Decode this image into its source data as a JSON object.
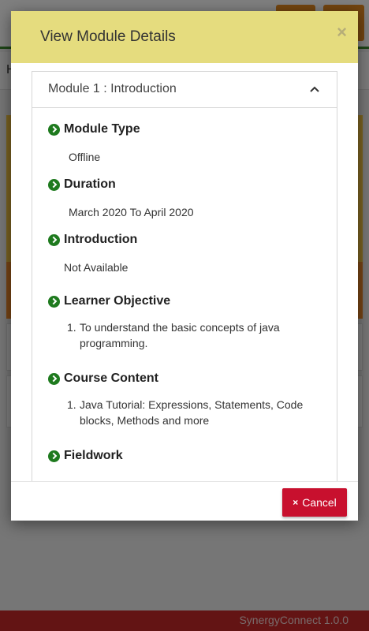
{
  "background": {
    "breadcrumb_initial": "H",
    "footer_text": "SynergyConnect 1.0.0"
  },
  "modal": {
    "title": "View Module Details",
    "close_glyph": "×",
    "panel_title": "Module 1 : Introduction",
    "sections": [
      {
        "title": "Module Type",
        "value": "Offline"
      },
      {
        "title": "Duration",
        "value": "March 2020 To April 2020"
      },
      {
        "title": "Introduction",
        "value": "Not Available"
      },
      {
        "title": "Learner Objective",
        "item_num": "1.",
        "item": "To understand the basic concepts of java programming."
      },
      {
        "title": "Course Content",
        "item_num": "1.",
        "item": "Java Tutorial: Expressions, Statements, Code blocks, Methods and more"
      },
      {
        "title": "Fieldwork"
      }
    ],
    "cancel_label": "Cancel",
    "cancel_icon": "×"
  },
  "colors": {
    "header_bg": "#e5dc7e",
    "icon_green": "#1e7a1e",
    "cancel_red": "#c8102e",
    "footer_red": "#c62828"
  },
  "icons": [
    "close-icon",
    "chevron-up-icon",
    "circle-arrow-right-icon",
    "cancel-x-icon"
  ]
}
